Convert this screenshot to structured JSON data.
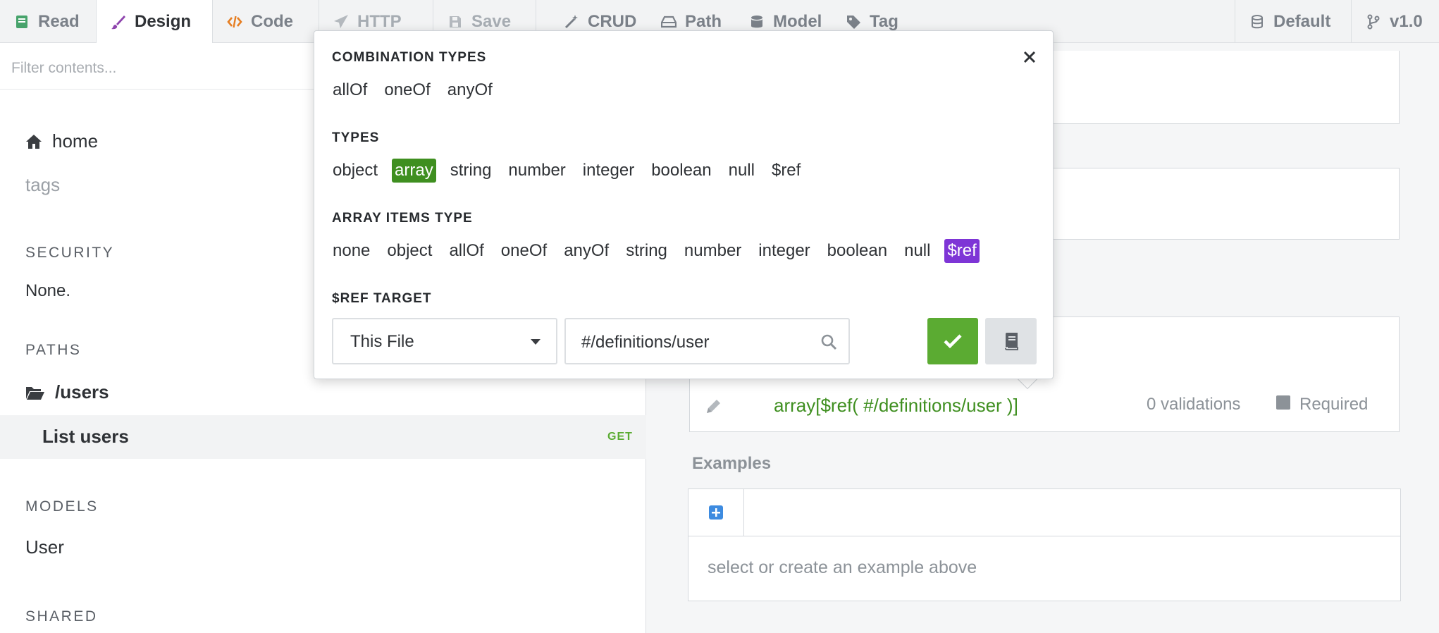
{
  "toolbar": {
    "tabs": [
      {
        "label": "Read",
        "icon": "book-icon",
        "color": "#47a36b"
      },
      {
        "label": "Design",
        "icon": "brush-icon",
        "color": "#8e44ad"
      },
      {
        "label": "Code",
        "icon": "code-icon",
        "color": "#e67e22"
      },
      {
        "label": "HTTP",
        "icon": "paper-plane-icon",
        "color": "#a7adb3"
      },
      {
        "label": "Save",
        "icon": "floppy-disk-icon",
        "color": "#a7adb3"
      },
      {
        "label": "CRUD",
        "icon": "magic-wand-icon",
        "color": "#7b8189"
      },
      {
        "label": "Path",
        "icon": "drive-icon",
        "color": "#7b8189"
      },
      {
        "label": "Model",
        "icon": "database-icon",
        "color": "#7b8189"
      },
      {
        "label": "Tag",
        "icon": "tag-icon",
        "color": "#7b8189"
      }
    ],
    "branch_default": "Default",
    "version": "v1.0"
  },
  "sidebar": {
    "filter_placeholder": "Filter contents...",
    "home": "home",
    "tags": "tags",
    "security_heading": "SECURITY",
    "security_value": "None.",
    "paths_heading": "PATHS",
    "path": "/users",
    "operation": "List users",
    "operation_method": "GET",
    "models_heading": "MODELS",
    "model": "User",
    "shared_heading": "SHARED"
  },
  "popover": {
    "combination_heading": "COMBINATION TYPES",
    "combination_types": [
      "allOf",
      "oneOf",
      "anyOf"
    ],
    "types_heading": "TYPES",
    "types": [
      "object",
      "array",
      "string",
      "number",
      "integer",
      "boolean",
      "null",
      "$ref"
    ],
    "selected_type": "array",
    "array_items_heading": "ARRAY ITEMS TYPE",
    "array_items_types": [
      "none",
      "object",
      "allOf",
      "oneOf",
      "anyOf",
      "string",
      "number",
      "integer",
      "boolean",
      "null",
      "$ref"
    ],
    "selected_array_item": "$ref",
    "ref_target_heading": "$REF TARGET",
    "ref_source": "This File",
    "ref_path": "#/definitions/user",
    "colors": {
      "selected_type": "#3f8f20",
      "selected_item": "#7e35d6",
      "confirm": "#5bab32"
    }
  },
  "main": {
    "schema_summary": "array[$ref( #/definitions/user )]",
    "validations": "0 validations",
    "required_label": "Required",
    "examples_heading": "Examples",
    "examples_empty": "select or create an example above"
  }
}
